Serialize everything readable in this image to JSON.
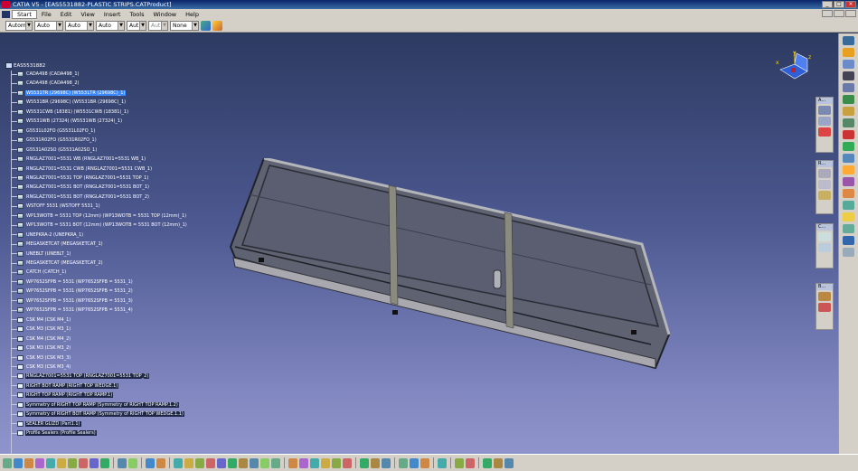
{
  "window": {
    "title": "CATIA V5 - [EAS5531882-PLASTIC STRIPS.CATProduct]",
    "min": "_",
    "max": "□",
    "close": "×"
  },
  "menu": [
    "Start",
    "File",
    "Edit",
    "View",
    "Insert",
    "Tools",
    "Window",
    "Help"
  ],
  "toolbar": {
    "combos": [
      "Autom",
      "Auto",
      "Auto",
      "Auto",
      "Aut",
      "Aut",
      "None"
    ]
  },
  "tree": {
    "root": "EAS5531882",
    "items": [
      "CADA498 (CADA498_1)",
      "CADA498 (CADA498_2)",
      "W5531TR (29698C) (W5531TR (29698C)_1)",
      "W5531BR (29698C) (W5531BR (29698C)_1)",
      "W5531CWB (18381) (W5531CWB (18381)_1)",
      "W5531WB (27324) (W5531WB (27324)_1)",
      "G5531L02FO (G5531L02FO_1)",
      "G5531R02FO (G5531R02FO_1)",
      "G5531A02SO (G5531A02SO_1)",
      "RNGLAZ7001=5531 WB (RNGLAZ7001=5531 WB_1)",
      "RNGLAZ7001=5531 CWB (RNGLAZ7001=5531 CWB_1)",
      "RNGLAZ7001=5531 TOP (RNGLAZ7001=5531 TOP_1)",
      "RNGLAZ7001=5531 BOT (RNGLAZ7001=5531 BOT_1)",
      "RNGLAZ7001=5531 BOT (RNGLAZ7001=5531 BOT_2)",
      "WSTOFF 5531 (WSTOFF 5531_1)",
      "WP13WOTB = 5531 TOP (12mm) (WP13WOTB = 5531 TOP (12mm)_1)",
      "WP13WOTB = 5531 BOT (12mm) (WP13WOTB = 5531 BOT (12mm)_1)",
      "UNEPKRA-2 (UNEPKRA_1)",
      "MEGASKETCAT (MEGASKETCAT_1)",
      "UNEBLT (UNEBLT_1)",
      "MEGASKETCAT (MEGASKETCAT_2)",
      "CATCH (CATCH_1)",
      "WP7652SFPB = 5531 (WP7652SFPB = 5531_1)",
      "WP7652SFPB = 5531 (WP7652SFPB = 5531_2)",
      "WP7652SFPB = 5531 (WP7652SFPB = 5531_3)",
      "WP7652SFPB = 5531 (WP7652SFPB = 5531_4)",
      "CSK M4 (CSK M4_1)",
      "CSK M3 (CSK M3_1)",
      "CSK M4 (CSK M4_2)",
      "CSK M3 (CSK M3_2)",
      "CSK M3 (CSK M3_3)",
      "CSK M3 (CSK M3_4)",
      "RNGLAZ7001=5531 TOP (RNGLAZ7001=5531 TOP_2)",
      "RIGHT BOT RAMP (RIGHT TOP WEDGE.1)",
      "RIGHT TOP RAMP (RIGHT TOP RAMP.1)",
      "Symmetry of RIGHT TOP RAMP (Symmetry of RIGHT TOP RAMP.1.2)",
      "Symmetry of RIGHT BOT RAMP (Symmetry of RIGHT TOP WEDGE.1.1)",
      "SEALER GLIZD (Part1.1)",
      "Profile Sealers (Profile Sealers)"
    ]
  },
  "compass": {
    "x": "x",
    "y": "y",
    "z": "z"
  },
  "palettes": [
    {
      "header": "A..."
    },
    {
      "header": "R..."
    },
    {
      "header": "C..."
    },
    {
      "header": "B..."
    }
  ],
  "axis_mini": {
    "x": "x",
    "z": "z"
  },
  "colors": {
    "selection": "#3a86ff",
    "viewport_top": "#2d3b62",
    "viewport_bottom": "#9094cc"
  }
}
